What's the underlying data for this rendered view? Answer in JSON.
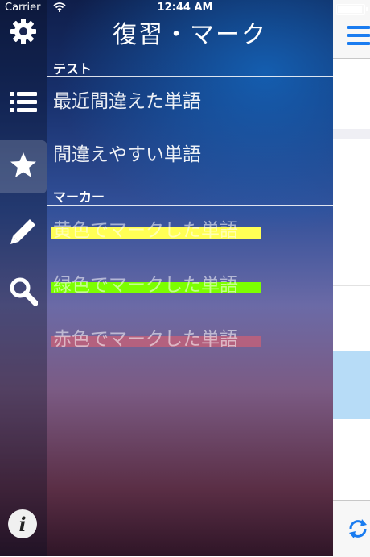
{
  "status_bar": {
    "carrier": "Carrier",
    "time": "12:44 AM"
  },
  "header": {
    "title": "復習・マーク"
  },
  "sections": {
    "test": {
      "header": "テスト",
      "items": [
        {
          "label": "最近間違えた単語"
        },
        {
          "label": "間違えやすい単語"
        }
      ]
    },
    "marker": {
      "header": "マーカー",
      "items": [
        {
          "label": "黄色でマークした単語",
          "color": "#ffff55"
        },
        {
          "label": "緑色でマークした単語",
          "color": "#7cff00"
        },
        {
          "label": "赤色でマークした単語",
          "color": "#c0607a"
        }
      ]
    }
  },
  "side_icons": [
    {
      "icon": "gear-icon"
    },
    {
      "icon": "list-icon"
    },
    {
      "icon": "star-icon",
      "active": true
    },
    {
      "icon": "pencil-icon"
    },
    {
      "icon": "search-icon"
    },
    {
      "icon": "info-icon"
    }
  ],
  "colors": {
    "accent": "#1a7cf0",
    "selected_row": "#b7dcf7"
  }
}
